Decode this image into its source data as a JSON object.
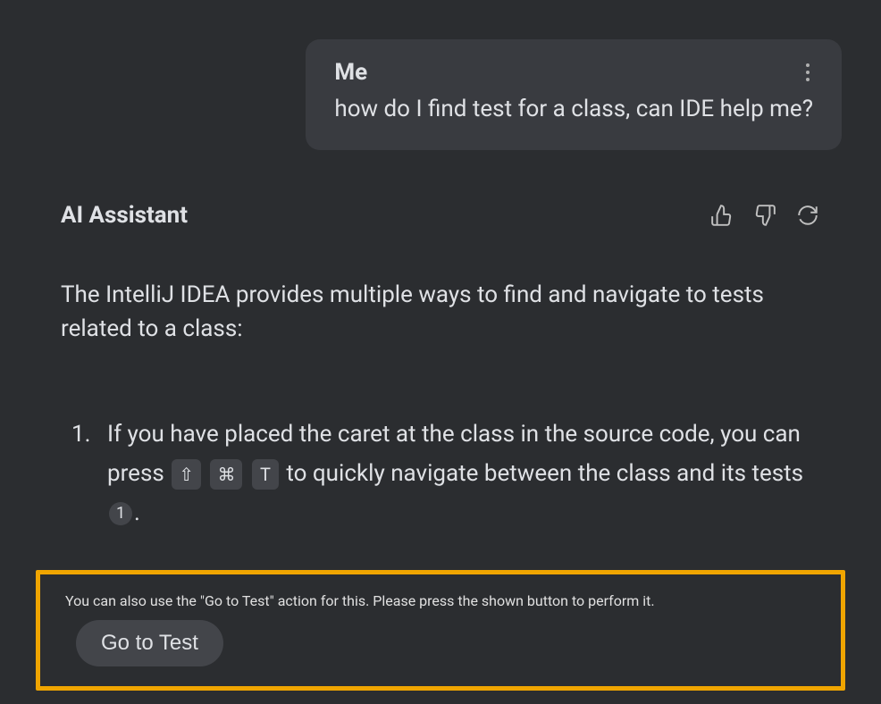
{
  "user_message": {
    "label": "Me",
    "text": "how do I find test for a class, can IDE help me?"
  },
  "assistant": {
    "label": "AI Assistant",
    "intro": "The IntelliJ IDEA provides multiple ways to find and navigate to tests related to a class:",
    "items": {
      "item1": {
        "text_before_keys": "If you have placed the caret at the class in the source code, you can press ",
        "key1": "⇧",
        "key2": "⌘",
        "key3": "T",
        "text_after_keys": " to quickly navigate between the class and its tests ",
        "ref": "1",
        "text_end": "."
      },
      "item2": {
        "text": "You can also use the \"Go to Test\" action for this. Please press the shown button to perform it.",
        "button_label": "Go to Test"
      }
    }
  }
}
